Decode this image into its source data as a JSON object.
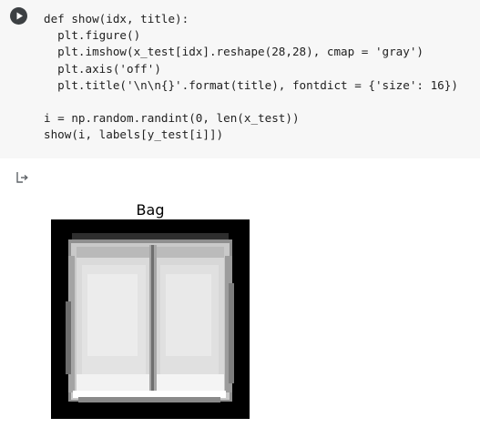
{
  "code_cell": {
    "lines": [
      "def show(idx, title):",
      "  plt.figure()",
      "  plt.imshow(x_test[idx].reshape(28,28), cmap = 'gray')",
      "  plt.axis('off')",
      "  plt.title('\\n\\n{}'.format(title), fontdict = {'size': 16})",
      "",
      "i = np.random.randint(0, len(x_test))",
      "show(i, labels[y_test[i]])"
    ]
  },
  "output": {
    "figure_title": "Bag"
  },
  "icons": {
    "run": "play-icon",
    "output": "output-arrow-icon"
  },
  "colors": {
    "cell_background": "#f7f7f7",
    "run_button": "#3c4043",
    "image_background": "#000000"
  }
}
